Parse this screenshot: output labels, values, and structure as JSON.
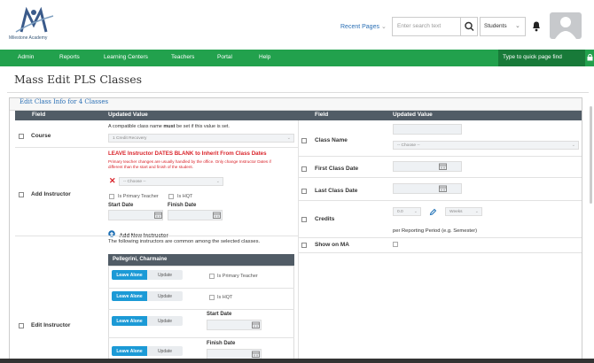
{
  "header": {
    "logo_text": "Milestone Academy",
    "recent_pages": "Recent Pages",
    "search_placeholder": "Enter search text",
    "context": "Students"
  },
  "nav": {
    "items": [
      "Admin",
      "Reports",
      "Learning Centers",
      "Teachers",
      "Portal",
      "Help"
    ],
    "quick_find": "Type to quick page find"
  },
  "page": {
    "title": "Mass Edit PLS Classes",
    "panel_title": "Edit Class Info for 4 Classes"
  },
  "table": {
    "col_field": "Field",
    "col_updated": "Updated Value"
  },
  "left": {
    "course": {
      "label": "Course",
      "note_pre": "A compatible class name ",
      "note_bold": "must",
      "note_post": " be set if this value is set.",
      "select": "1 Credit Recovery"
    },
    "add_instructor": {
      "label": "Add Instructor",
      "warn": "LEAVE Instructor DATES BLANK to Inherit From Class Dates",
      "note1": "Primary teacher changes are usually handled by the office. Only change Instructor Dates if",
      "note2": "different than the start and finish of the student.",
      "select": "-- Choose --",
      "primary": "Is Primary Teacher",
      "hqt": "Is HQT",
      "start": "Start Date",
      "finish": "Finish Date",
      "add_new": "Add New Instructor"
    },
    "edit_instructor": {
      "label": "Edit Instructor",
      "note": "The following instructors are common among the selected classes.",
      "name": "Pellegrini, Charmaine",
      "leave": "Leave Alone",
      "update": "Update",
      "primary": "Is Primary Teacher",
      "hqt": "Is HQT",
      "start": "Start Date",
      "finish": "Finish Date"
    }
  },
  "right": {
    "class_name": {
      "label": "Class Name",
      "select": "-- Choose --"
    },
    "first_date": {
      "label": "First Class Date"
    },
    "last_date": {
      "label": "Last Class Date"
    },
    "credits": {
      "label": "Credits",
      "value": "0.0",
      "unit": "Weeks",
      "note": "per Reporting Period (e.g. Semester)"
    },
    "show_ma": {
      "label": "Show on MA"
    }
  },
  "colors": {
    "nav": "#22a14d",
    "nav_dark": "#187a39",
    "table_head": "#515c66",
    "button": "#1c9ad6",
    "warn": "#d9232a",
    "link": "#2a6fb5"
  }
}
